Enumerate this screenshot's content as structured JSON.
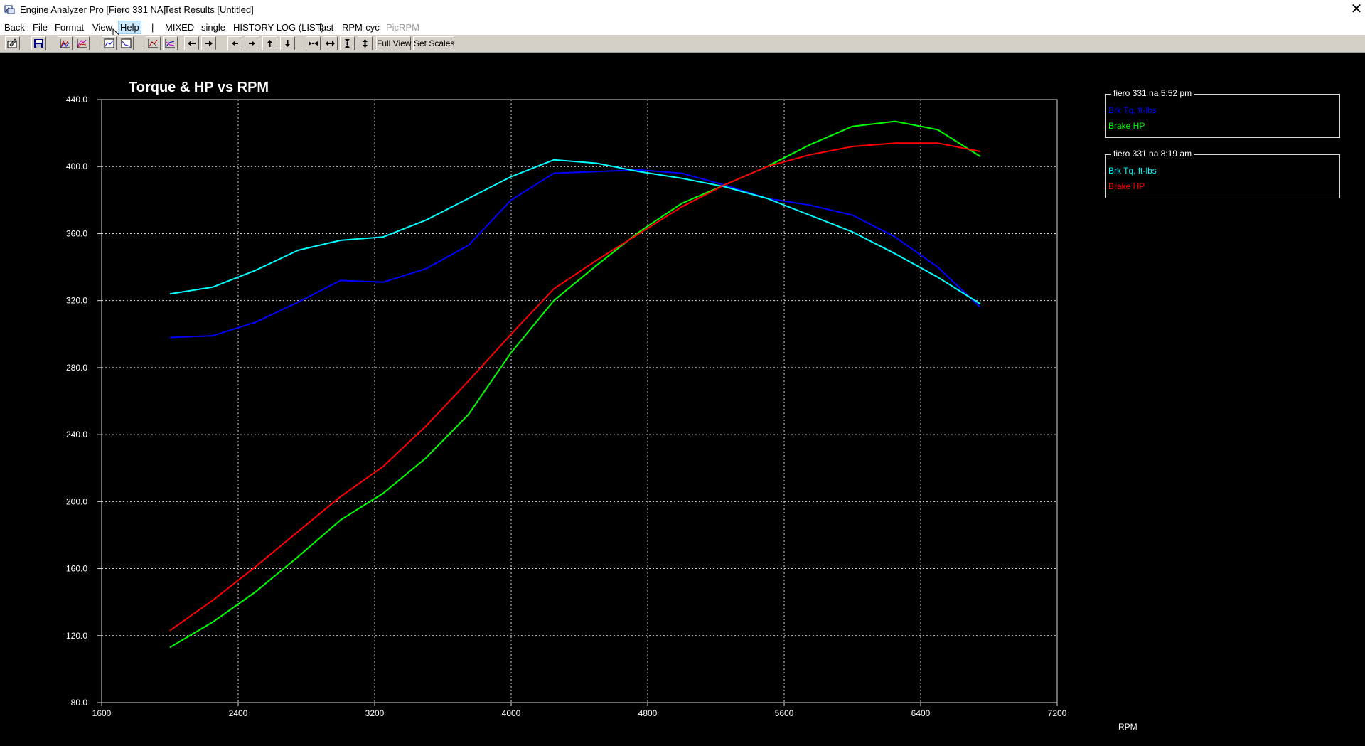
{
  "window": {
    "app_title": "Engine Analyzer Pro [Fiero 331 NA]",
    "doc_title": "Test Results [Untitled]",
    "close_glyph": "✕"
  },
  "menu": {
    "items": [
      {
        "label": "Back"
      },
      {
        "label": "File"
      },
      {
        "label": "Format"
      },
      {
        "label": "View"
      },
      {
        "label": "Help"
      },
      {
        "label": "|"
      },
      {
        "label": "MIXED"
      },
      {
        "label": "single"
      },
      {
        "label": "HISTORY LOG (LIST)"
      },
      {
        "label": "last"
      },
      {
        "label": "RPM-cyc"
      },
      {
        "label": "PicRPM"
      }
    ]
  },
  "toolbar": {
    "buttons": [
      {
        "icon": "edit-icon"
      },
      {
        "icon": "save-icon"
      },
      {
        "icon": "graph-icon"
      },
      {
        "icon": "graph-icon"
      },
      {
        "icon": "graph-icon"
      },
      {
        "icon": "graph-icon"
      },
      {
        "icon": "graph-icon"
      },
      {
        "icon": "graph-icon"
      },
      {
        "icon": "cursor-left-icon"
      },
      {
        "icon": "cursor-right-icon"
      },
      {
        "icon": "arrow-left-icon"
      },
      {
        "icon": "arrow-right-icon"
      },
      {
        "icon": "arrow-up-icon"
      },
      {
        "icon": "arrow-down-icon"
      },
      {
        "icon": "compress-horizontal-icon"
      },
      {
        "icon": "expand-horizontal-icon"
      },
      {
        "icon": "compress-vertical-icon"
      },
      {
        "icon": "expand-vertical-icon"
      }
    ],
    "full_view_label": "Full View",
    "set_scales_label": "Set Scales"
  },
  "legends": [
    {
      "title": "fiero 331 na 5:52 pm",
      "items": [
        {
          "label": "Brk Tq, ft-lbs",
          "color": "#0000ff"
        },
        {
          "label": "Brake HP",
          "color": "#00ff00"
        }
      ]
    },
    {
      "title": "fiero 331 na 8:19 am",
      "items": [
        {
          "label": "Brk Tq, ft-lbs",
          "color": "#00ffff"
        },
        {
          "label": "Brake HP",
          "color": "#ff0000"
        }
      ]
    }
  ],
  "chart_data": {
    "type": "line",
    "title": "Torque & HP vs RPM",
    "xlabel": "RPM",
    "ylabel": "",
    "xlim": [
      1600,
      7200
    ],
    "ylim": [
      80,
      440
    ],
    "xticks": [
      "1600",
      "2400",
      "3200",
      "4000",
      "4800",
      "5600",
      "6400",
      "7200"
    ],
    "yticks": [
      "440.0",
      "400.0",
      "360.0",
      "320.0",
      "280.0",
      "240.0",
      "200.0",
      "160.0",
      "120.0",
      "80.0"
    ],
    "grid": true,
    "background": "#000000",
    "series": [
      {
        "color": "#0000ff",
        "x": [
          2000,
          2250,
          2500,
          2750,
          3000,
          3250,
          3500,
          3750,
          4000,
          4250,
          4500,
          4750,
          5000,
          5250,
          5500,
          5750,
          6000,
          6250,
          6500,
          6750
        ],
        "y": [
          298,
          299,
          307,
          319,
          332,
          331,
          339,
          353,
          380,
          396,
          397,
          398,
          396,
          389,
          381,
          377,
          371,
          358,
          340,
          316
        ]
      },
      {
        "color": "#00ff00",
        "x": [
          2000,
          2250,
          2500,
          2750,
          3000,
          3250,
          3500,
          3750,
          4000,
          4250,
          4500,
          4750,
          5000,
          5250,
          5500,
          5750,
          6000,
          6250,
          6500,
          6750
        ],
        "y": [
          113,
          128,
          146,
          167,
          189,
          205,
          226,
          252,
          289,
          320,
          341,
          361,
          378,
          389,
          400,
          413,
          424,
          427,
          422,
          406
        ]
      },
      {
        "color": "#00ffff",
        "x": [
          2000,
          2250,
          2500,
          2750,
          3000,
          3250,
          3500,
          3750,
          4000,
          4250,
          4500,
          4750,
          5000,
          5250,
          5500,
          5750,
          6000,
          6250,
          6500,
          6750
        ],
        "y": [
          324,
          328,
          338,
          350,
          356,
          358,
          368,
          381,
          394,
          404,
          402,
          397,
          393,
          388,
          381,
          371,
          361,
          348,
          334,
          318
        ]
      },
      {
        "color": "#ff0000",
        "x": [
          2000,
          2250,
          2500,
          2750,
          3000,
          3250,
          3500,
          3750,
          4000,
          4250,
          4500,
          4750,
          5000,
          5250,
          5500,
          5750,
          6000,
          6250,
          6500,
          6750
        ],
        "y": [
          123,
          141,
          161,
          182,
          203,
          221,
          245,
          272,
          300,
          327,
          344,
          360,
          376,
          389,
          400,
          407,
          412,
          414,
          414,
          409
        ]
      }
    ]
  }
}
